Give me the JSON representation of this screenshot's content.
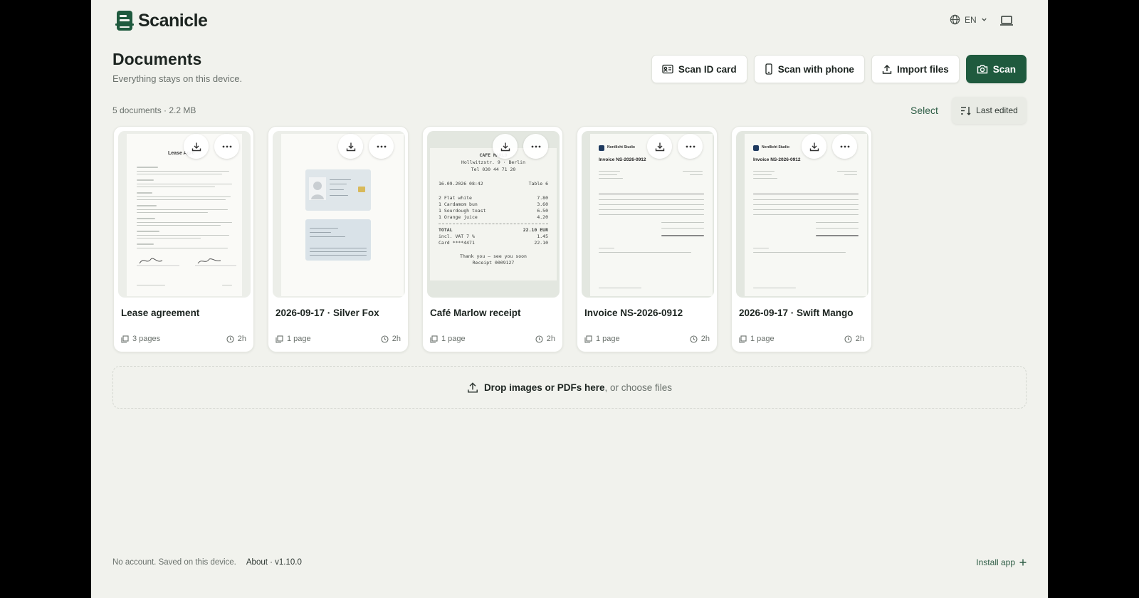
{
  "app": {
    "name": "Scanicle",
    "language": "EN",
    "accent_color": "#1f5a3e"
  },
  "header": {
    "title": "Documents",
    "subtitle": "Everything stays on this device."
  },
  "actions": {
    "scan_id_label": "Scan ID card",
    "scan_phone_label": "Scan with phone",
    "import_label": "Import files",
    "scan_label": "Scan"
  },
  "summary": {
    "text": "5 documents · 2.2 MB",
    "select_label": "Select",
    "sort_label": "Last edited"
  },
  "documents": [
    {
      "title": "Lease agreement",
      "pages": "3 pages",
      "age": "2h",
      "kind": "contract"
    },
    {
      "title": "2026-09-17 · Silver Fox",
      "pages": "1 page",
      "age": "2h",
      "kind": "id-card"
    },
    {
      "title": "Café Marlow receipt",
      "pages": "1 page",
      "age": "2h",
      "kind": "receipt"
    },
    {
      "title": "Invoice NS-2026-0912",
      "pages": "1 page",
      "age": "2h",
      "kind": "invoice"
    },
    {
      "title": "2026-09-17 · Swift Mango",
      "pages": "1 page",
      "age": "2h",
      "kind": "invoice"
    }
  ],
  "thumbnails": {
    "lease_heading": "Lease Agre",
    "receipt": {
      "shop": "CAFE MARLO",
      "address": "Hollwitzstr. 9 · Berlin",
      "phone": "Tel 030 44 71 20",
      "datetime": "16.09.2026 08:42",
      "table": "Table 6",
      "items": [
        {
          "name": "2 Flat white",
          "price": "7.80"
        },
        {
          "name": "1 Cardamom bun",
          "price": "3.60"
        },
        {
          "name": "1 Sourdough toast",
          "price": "6.50"
        },
        {
          "name": "1 Orange juice",
          "price": "4.20"
        }
      ],
      "total_label": "TOTAL",
      "total": "22.10 EUR",
      "vat_label": "incl. VAT 7 %",
      "vat": "1.45",
      "card_label": "Card ****4471",
      "card": "22.10",
      "thanks": "Thank you — see you soon",
      "receipt_no": "Receipt 0009127"
    },
    "invoice_title": "Invoice NS-2026-0912",
    "invoice_company": "Nordlicht Studio"
  },
  "dropzone": {
    "strong": "Drop images or PDFs here",
    "rest": ", or choose files"
  },
  "footer": {
    "note": "No account. Saved on this device.",
    "about": "About · v1.10.0",
    "install": "Install app"
  }
}
